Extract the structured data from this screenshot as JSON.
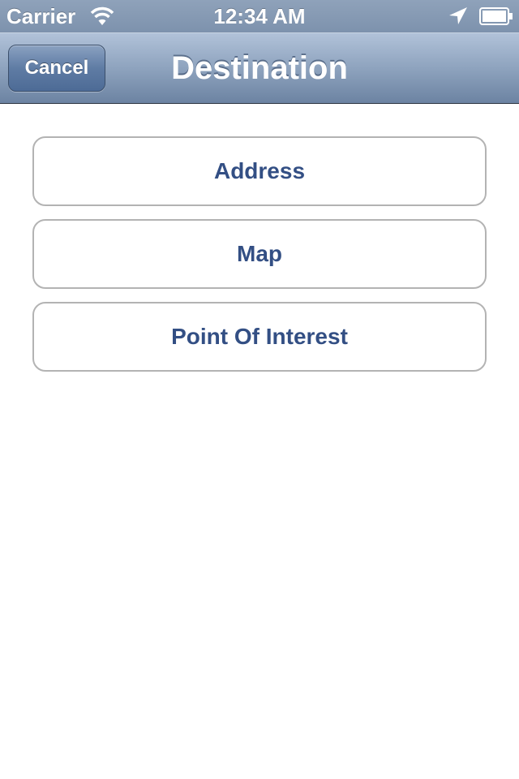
{
  "status_bar": {
    "carrier": "Carrier",
    "time": "12:34 AM",
    "icons": [
      "wifi-icon",
      "location-icon",
      "battery-icon"
    ]
  },
  "nav_bar": {
    "title": "Destination",
    "cancel_label": "Cancel"
  },
  "options": [
    {
      "label": "Address"
    },
    {
      "label": "Map"
    },
    {
      "label": "Point Of Interest"
    }
  ],
  "colors": {
    "nav_bar": "#8ea3be",
    "button_text": "#334f84",
    "button_border": "#b3b3b3",
    "background": "#ffffff"
  }
}
